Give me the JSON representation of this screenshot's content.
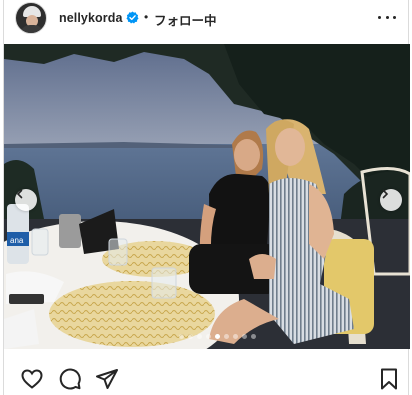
{
  "header": {
    "username": "nellykorda",
    "verified_badge_color": "#0095f6",
    "separator": "•",
    "follow_label": "フォロー中"
  },
  "photo": {
    "bottle_label": "ana",
    "carousel_count": 9,
    "carousel_active_index": 4
  },
  "icons": {
    "avatar": "avatar-icon",
    "verified": "verified-badge-icon",
    "more": "more-options-icon",
    "prev": "chevron-left-icon",
    "next": "chevron-right-icon",
    "like": "heart-icon",
    "comment": "comment-icon",
    "share": "paper-plane-icon",
    "save": "bookmark-icon"
  }
}
